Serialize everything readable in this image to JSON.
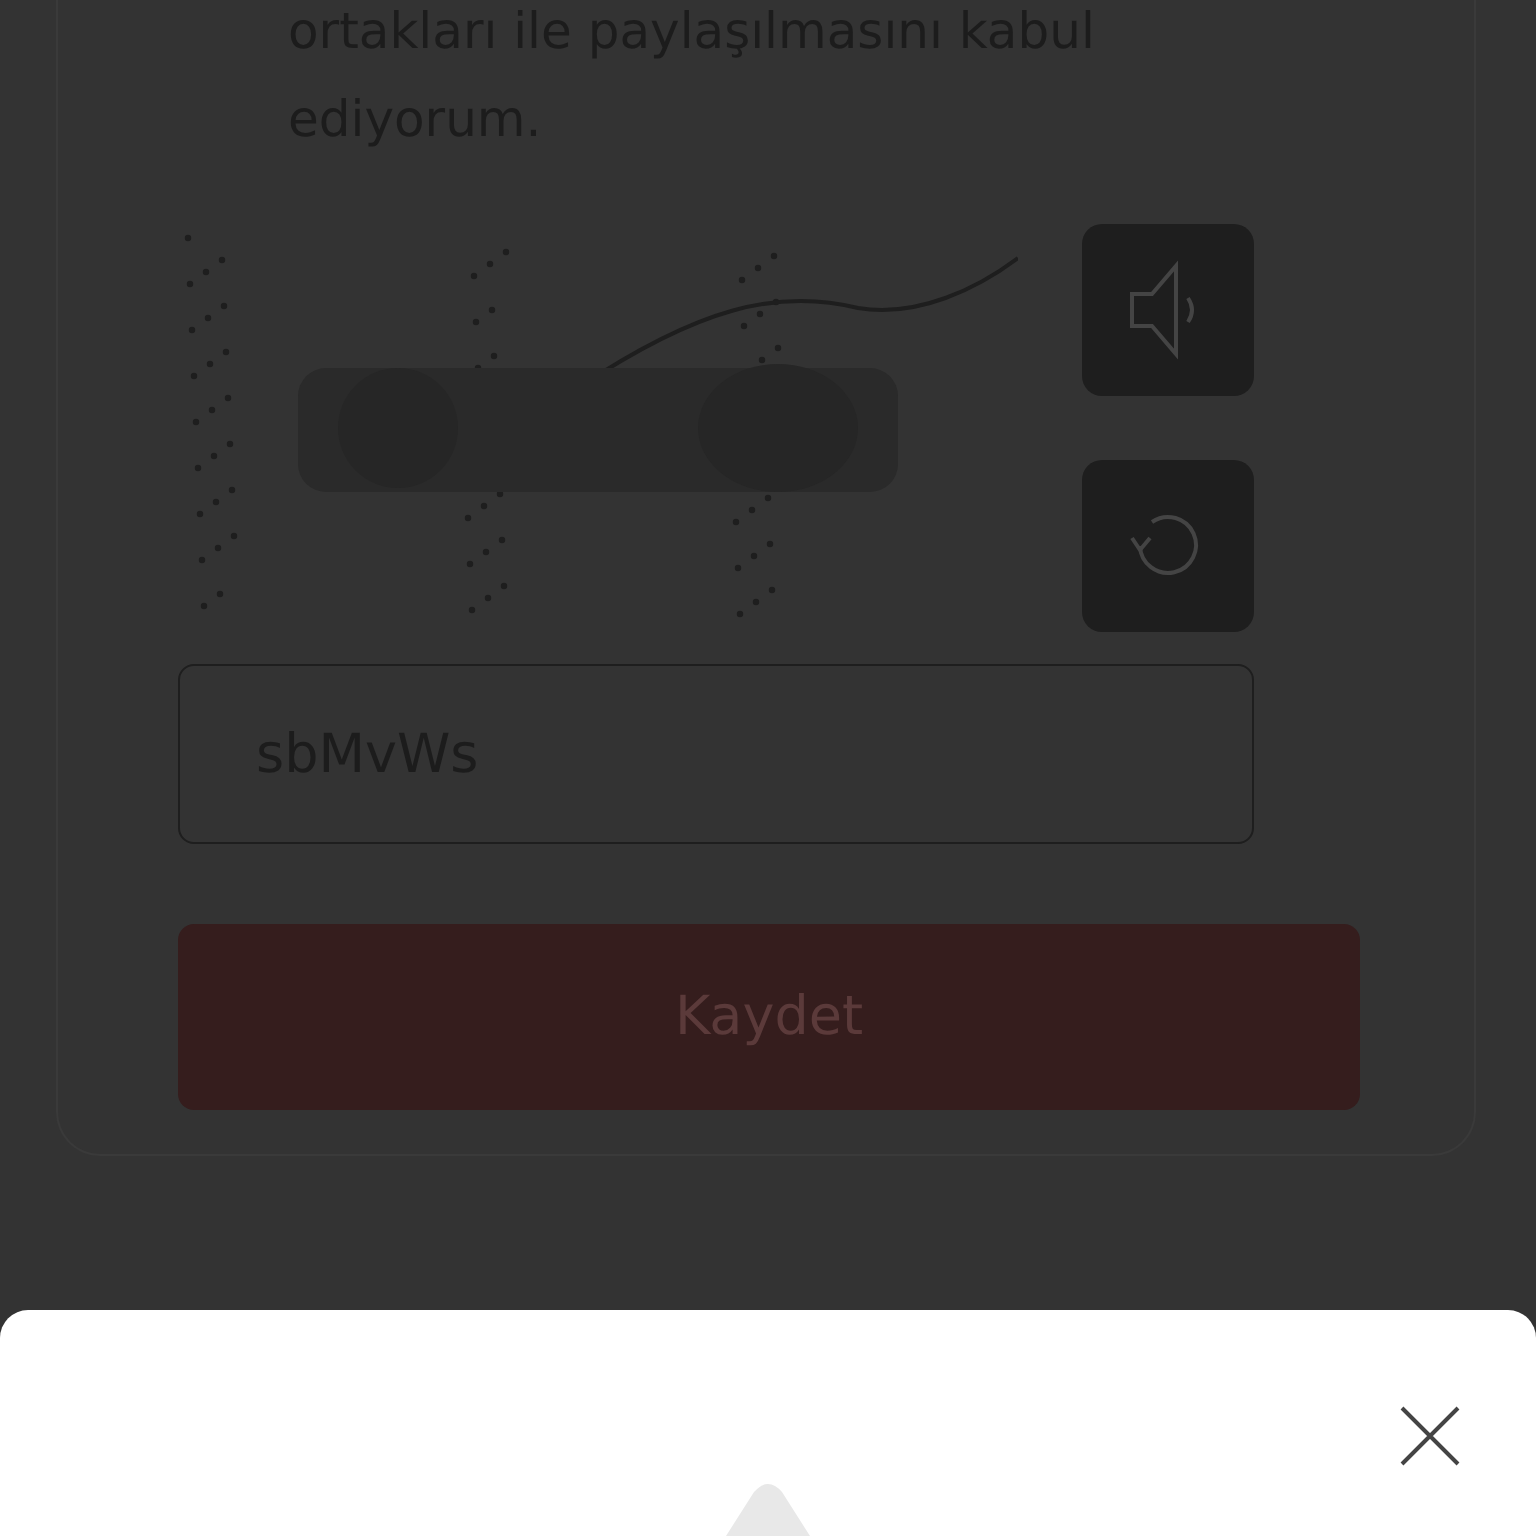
{
  "consent_text": "ortakları ile paylaşılmasını kabul ediyorum.",
  "captcha": {
    "input": {
      "value": "sbMvWs"
    }
  },
  "submit_button": {
    "label": "Kaydet"
  },
  "bottom_sheet": {
    "icon": {
      "kind": "triangle"
    }
  }
}
